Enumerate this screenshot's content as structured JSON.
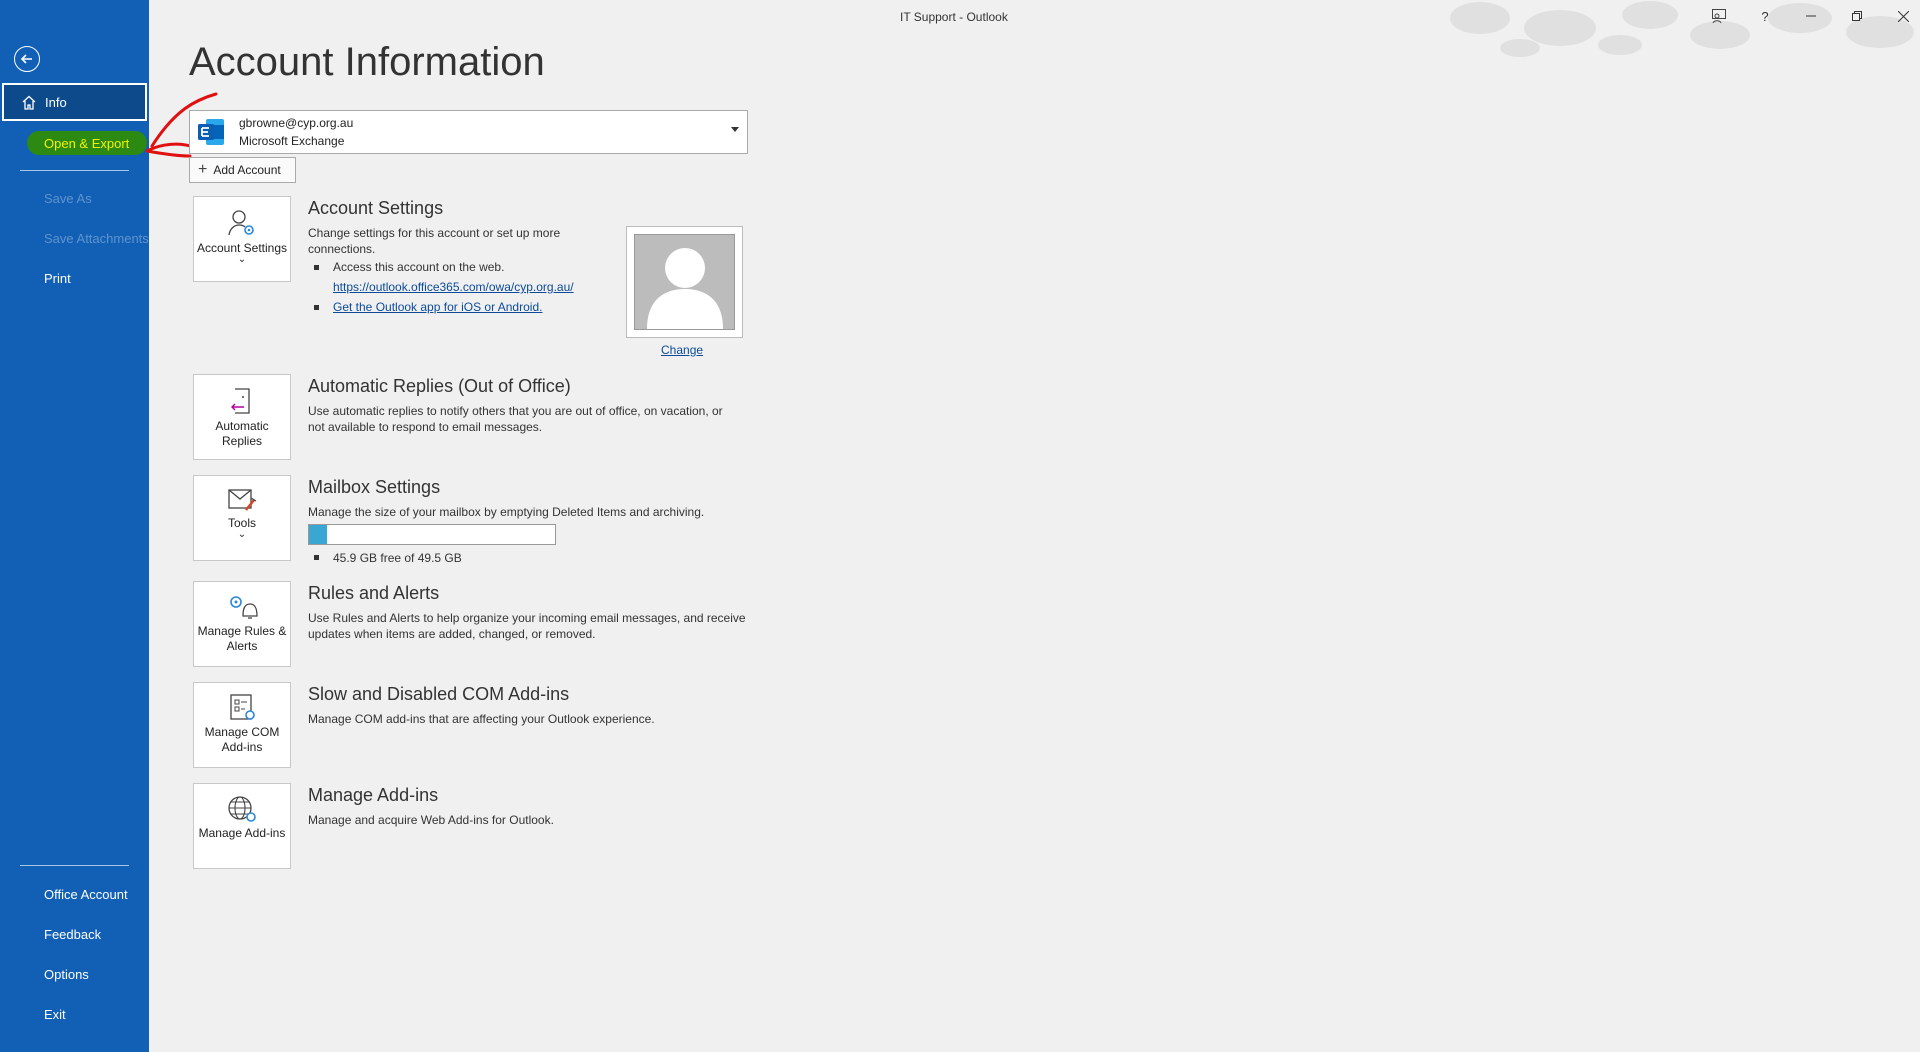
{
  "window": {
    "title": "IT Support  -  Outlook"
  },
  "sidebar": {
    "info": "Info",
    "open_export": "Open & Export",
    "save_as": "Save As",
    "save_attachments": "Save Attachments",
    "print": "Print",
    "office_account": "Office Account",
    "feedback": "Feedback",
    "options": "Options",
    "exit": "Exit"
  },
  "main": {
    "title": "Account Information",
    "account": {
      "email": "gbrowne@cyp.org.au",
      "type": "Microsoft Exchange"
    },
    "add_account": "Add Account",
    "account_settings": {
      "tile_label": "Account Settings",
      "title": "Account Settings",
      "desc": "Change settings for this account or set up more connections.",
      "bullet1": "Access this account on the web.",
      "link1": "https://outlook.office365.com/owa/cyp.org.au/",
      "link2": "Get the Outlook app for iOS or Android.",
      "change": "Change"
    },
    "auto_replies": {
      "tile_label": "Automatic Replies",
      "title": "Automatic Replies (Out of Office)",
      "desc": "Use automatic replies to notify others that you are out of office, on vacation, or not available to respond to email messages."
    },
    "mailbox": {
      "tile_label": "Tools",
      "title": "Mailbox Settings",
      "desc": "Manage the size of your mailbox by emptying Deleted Items and archiving.",
      "usage_fraction": 0.073,
      "free_text": "45.9 GB free of 49.5 GB"
    },
    "rules": {
      "tile_label": "Manage Rules & Alerts",
      "title": "Rules and Alerts",
      "desc": "Use Rules and Alerts to help organize your incoming email messages, and receive updates when items are added, changed, or removed."
    },
    "com_addins": {
      "tile_label": "Manage COM Add-ins",
      "title": "Slow and Disabled COM Add-ins",
      "desc": "Manage COM add-ins that are affecting your Outlook experience."
    },
    "addins": {
      "tile_label": "Manage Add-ins",
      "title": "Manage Add-ins",
      "desc": "Manage and acquire Web Add-ins for Outlook."
    }
  },
  "colors": {
    "sidebar": "#1160b6",
    "highlight": "#2c8a13",
    "annotation_arrow": "#e01010",
    "progress": "#3aa7d3"
  },
  "icons": [
    "back-arrow-icon",
    "home-icon",
    "exchange-logo-icon",
    "plus-icon",
    "account-settings-icon",
    "auto-replies-icon",
    "tools-icon",
    "rules-icon",
    "com-addins-icon",
    "addins-globe-icon",
    "person-silhouette-icon",
    "coauthor-icon",
    "help-icon",
    "minimize-icon",
    "restore-icon",
    "close-icon"
  ]
}
